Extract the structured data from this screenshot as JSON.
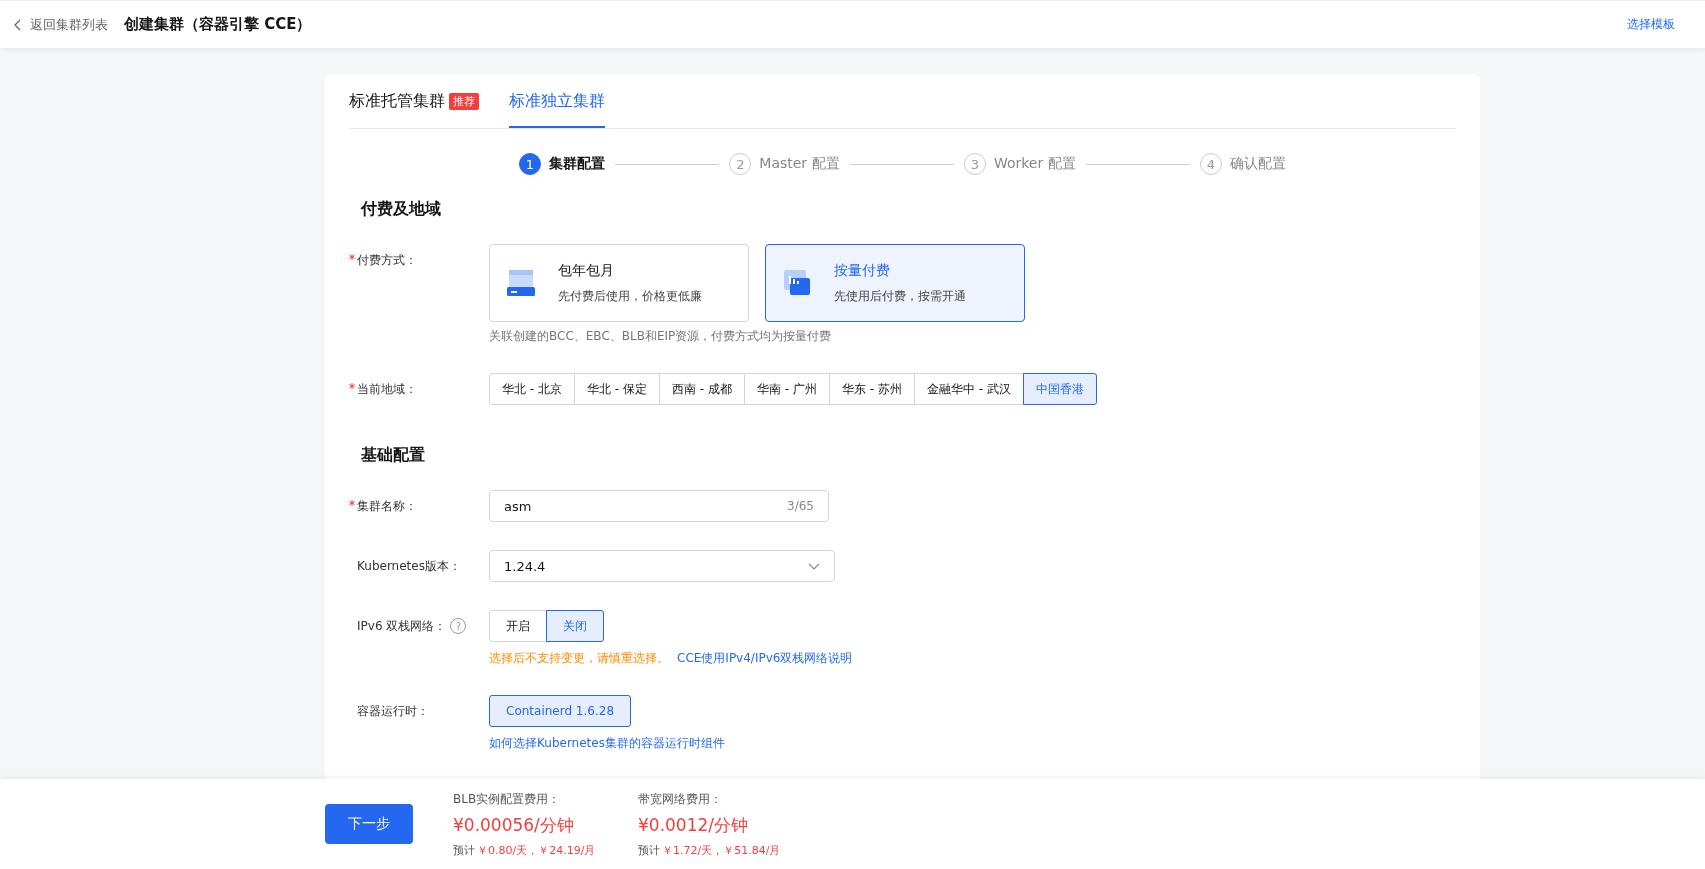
{
  "header": {
    "back_link": "返回集群列表",
    "title": "创建集群（容器引擎 CCE）",
    "template_link": "选择模板"
  },
  "tabs": [
    {
      "label": "标准托管集群",
      "badge": "推荐",
      "selected": false
    },
    {
      "label": "标准独立集群",
      "selected": true
    }
  ],
  "steps": [
    {
      "number": "1",
      "label": "集群配置",
      "selected": true
    },
    {
      "number": "2",
      "label": "Master 配置",
      "selected": false
    },
    {
      "number": "3",
      "label": "Worker 配置",
      "selected": false
    },
    {
      "number": "4",
      "label": "确认配置",
      "selected": false
    }
  ],
  "billing_section": {
    "title": "付费及地域",
    "payment": {
      "label": "付费方式：",
      "required": true,
      "options": [
        {
          "kind": "calendar",
          "title": "包年包月",
          "description": "先付费后使用，价格更低廉",
          "selected": false
        },
        {
          "kind": "meter",
          "title": "按量付费",
          "description": "先使用后付费，按需开通",
          "selected": true
        }
      ],
      "note": "关联创建的BCC、EBC、BLB和EIP资源，付费方式均为按量付费"
    },
    "region": {
      "label": "当前地域：",
      "required": true,
      "options": [
        {
          "label": "华北 - 北京",
          "selected": false
        },
        {
          "label": "华北 - 保定",
          "selected": false
        },
        {
          "label": "西南 - 成都",
          "selected": false
        },
        {
          "label": "华南 - 广州",
          "selected": false
        },
        {
          "label": "华东 - 苏州",
          "selected": false
        },
        {
          "label": "金融华中 - 武汉",
          "selected": false
        },
        {
          "label": "中国香港",
          "selected": true
        }
      ]
    }
  },
  "basic_section": {
    "title": "基础配置",
    "cluster_name": {
      "label": "集群名称：",
      "required": true,
      "value": "asm",
      "counter": "3/65"
    },
    "k8s_version": {
      "label": "Kubernetes版本：",
      "value": "1.24.4"
    },
    "ipv6": {
      "label": "IPv6 双栈网络：",
      "help_icon": "?",
      "options": [
        {
          "label": "开启",
          "selected": false
        },
        {
          "label": "关闭",
          "selected": true
        }
      ],
      "warning": "选择后不支持变更，请慎重选择。",
      "link": "CCE使用IPv4/IPv6双栈网络说明"
    },
    "runtime": {
      "label": "容器运行时：",
      "options": [
        {
          "label": "Containerd 1.6.28",
          "selected": true
        }
      ],
      "link": "如何选择Kubernetes集群的容器运行时组件"
    }
  },
  "footer": {
    "next_button": "下一步",
    "costs": [
      {
        "label": "BLB实例配置费用：",
        "price": "¥0.00056/分钟",
        "estimate_prefix": "预计",
        "estimate": "￥0.80/天，￥24.19/月"
      },
      {
        "label": "带宽网络费用：",
        "price": "¥0.0012/分钟",
        "estimate_prefix": "预计",
        "estimate": "￥1.72/天，￥51.84/月"
      }
    ]
  }
}
